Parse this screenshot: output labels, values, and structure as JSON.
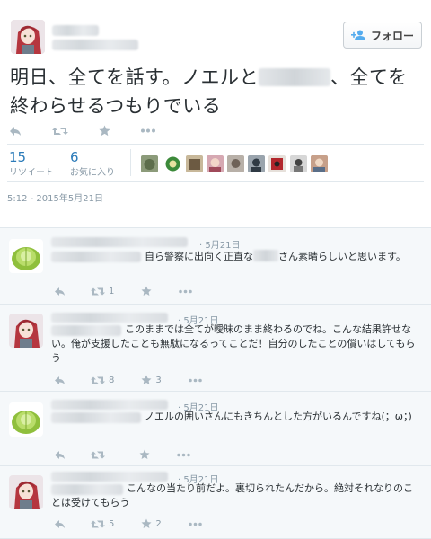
{
  "tweet": {
    "follow_label": "フォロー",
    "text_before": "明日、全てを話す。ノエルと",
    "text_after": "、全てを終わらせるつもりでいる",
    "retweets": "15",
    "retweets_label": "リツイート",
    "favorites": "6",
    "favorites_label": "お気に入り",
    "timestamp": "5:12 - 2015年5月21日"
  },
  "replies": [
    {
      "date": "· 5月21日",
      "text_a": "自ら警察に出向く正直な",
      "text_b": "さん素晴らしいと思います。",
      "retweets": "1",
      "avatar": "cabbage"
    },
    {
      "date": "· 5月21日",
      "text_a": "このままでは全てが曖昧のまま終わるのでね。こんな結果許せない。俺が支援したことも無駄になるってことだ！自分のしたことの償いはしてもらう",
      "text_b": "",
      "retweets": "8",
      "favorites": "3",
      "avatar": "girl"
    },
    {
      "date": "· 5月21日",
      "text_a": "ノエルの囲いさんにもきちんとした方がいるんですね(；ω；)",
      "text_b": "",
      "avatar": "cabbage"
    },
    {
      "date": "· 5月21日",
      "text_a": "こんなの当たり前だよ。裏切られたんだから。絶対それなりのことは受けてもらう",
      "text_b": "",
      "retweets": "5",
      "favorites": "2",
      "avatar": "girl"
    }
  ],
  "colors": {
    "accent": "#2b7bb9",
    "muted": "#8899a6",
    "icon": "#aab8c2"
  }
}
